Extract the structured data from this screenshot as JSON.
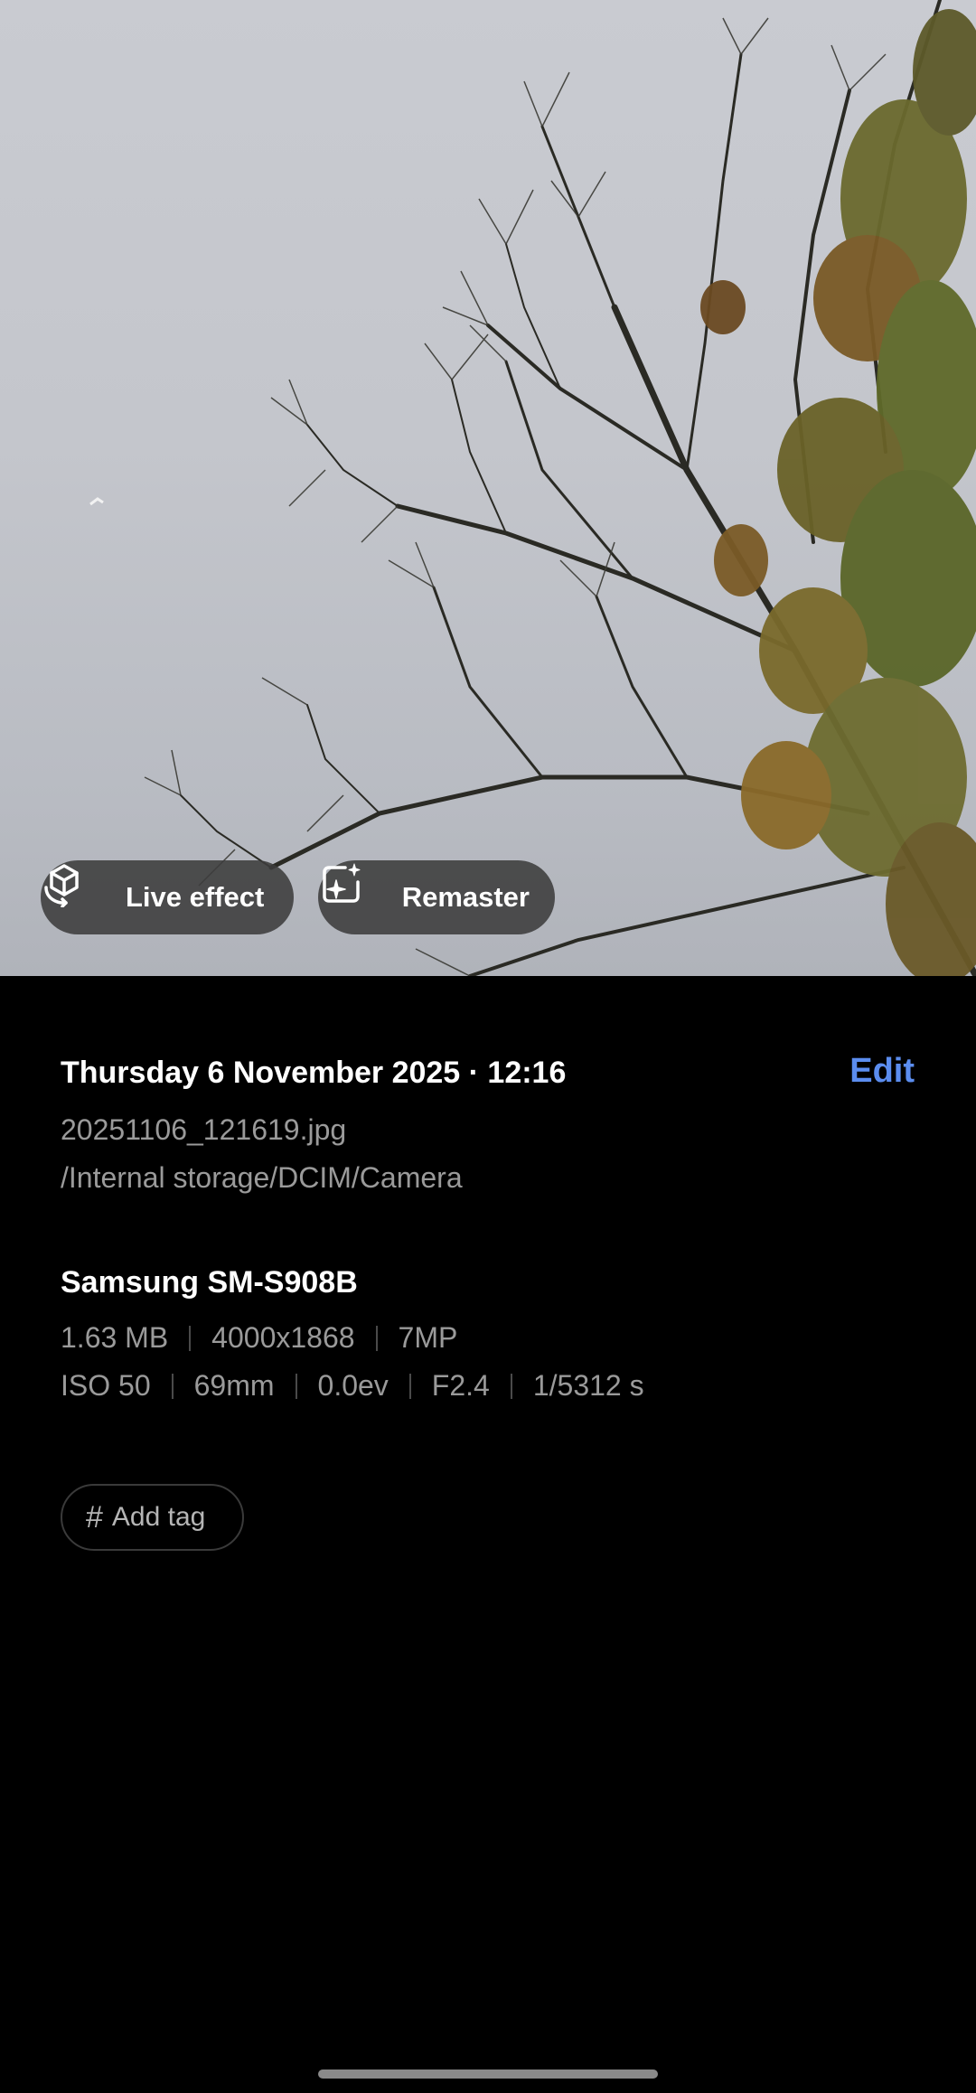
{
  "photo": {
    "subject_icon": "tree-branches-against-sky"
  },
  "actions": {
    "live_effect_label": "Live effect",
    "live_effect_icon": "cube-rotate-icon",
    "remaster_label": "Remaster",
    "remaster_icon": "sparkle-frame-icon"
  },
  "details": {
    "datetime": "Thursday 6 November 2025 · 12:16",
    "edit_label": "Edit",
    "filename": "20251106_121619.jpg",
    "path": "/Internal storage/DCIM/Camera",
    "device": "Samsung SM-S908B",
    "file_info": [
      "1.63 MB",
      "4000x1868",
      "7MP"
    ],
    "camera_info": [
      "ISO 50",
      "69mm",
      "0.0ev",
      "F2.4",
      "1/5312 s"
    ],
    "add_tag_label": "Add tag"
  },
  "colors": {
    "accent": "#5b8def",
    "background": "#000000",
    "secondary_text": "#9a9a9a"
  }
}
